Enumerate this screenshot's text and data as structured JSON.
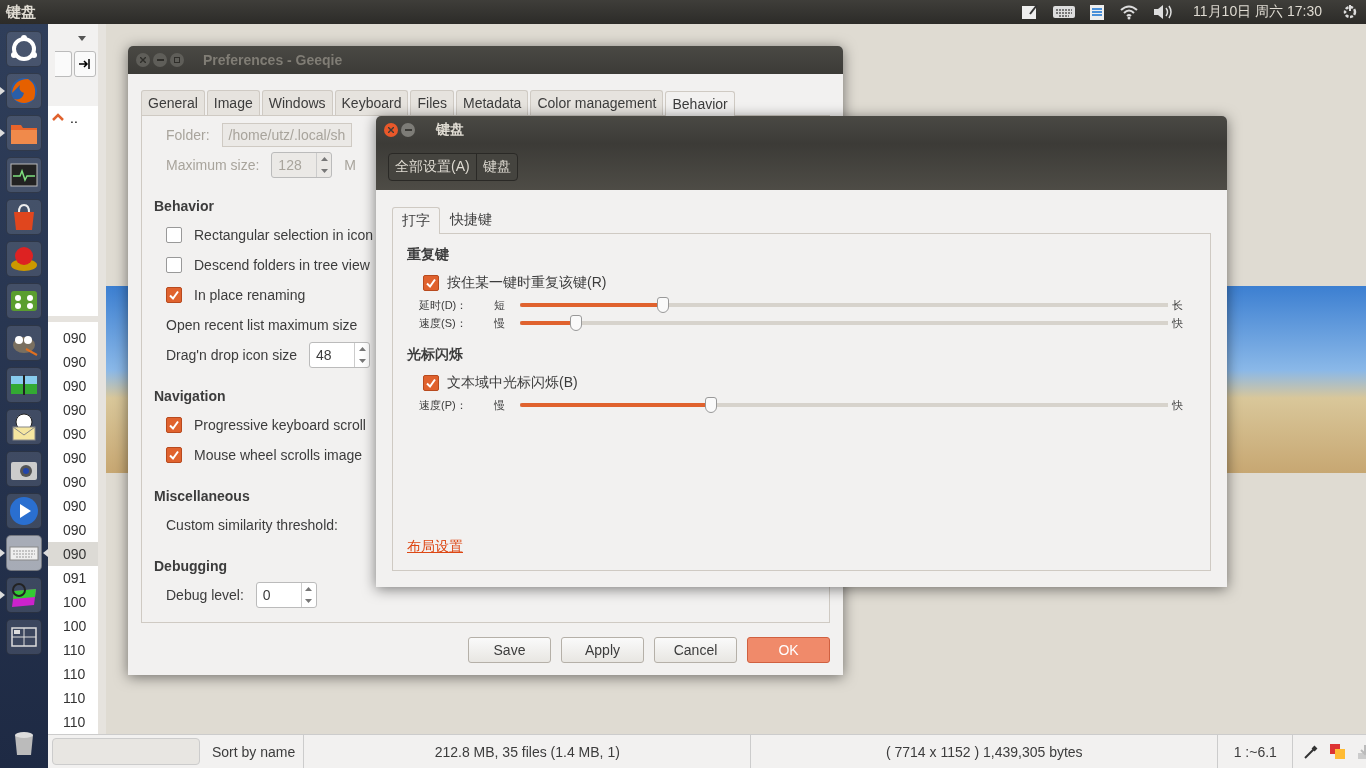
{
  "top_panel": {
    "app_title": "键盘",
    "clock": "11月10日 周六 17:30",
    "indicators": [
      {
        "kind": "pen"
      },
      {
        "kind": "keyboard"
      },
      {
        "kind": "notepad"
      },
      {
        "kind": "wifi"
      },
      {
        "kind": "volume"
      }
    ]
  },
  "launcher": [
    {
      "kind": "ubuntu",
      "running": false,
      "selected": false
    },
    {
      "kind": "firefox",
      "running": true,
      "selected": false
    },
    {
      "kind": "files",
      "running": true,
      "selected": false
    },
    {
      "kind": "monitor",
      "running": false,
      "selected": false
    },
    {
      "kind": "store",
      "running": false,
      "selected": false
    },
    {
      "kind": "disc",
      "running": false,
      "selected": false
    },
    {
      "kind": "dots",
      "running": false,
      "selected": false
    },
    {
      "kind": "gimp",
      "running": false,
      "selected": false
    },
    {
      "kind": "viewer",
      "running": false,
      "selected": false
    },
    {
      "kind": "mail",
      "running": false,
      "selected": false
    },
    {
      "kind": "camera",
      "running": false,
      "selected": false
    },
    {
      "kind": "player",
      "running": false,
      "selected": false
    },
    {
      "kind": "keyboard",
      "running": true,
      "selected": true
    },
    {
      "kind": "color",
      "running": true,
      "selected": false
    },
    {
      "kind": "workspaces",
      "running": false,
      "selected": false
    }
  ],
  "browser": {
    "parent_entry": "..",
    "files": [
      {
        "text": "090",
        "selected": false
      },
      {
        "text": "090",
        "selected": false
      },
      {
        "text": "090",
        "selected": false
      },
      {
        "text": "090",
        "selected": false
      },
      {
        "text": "090",
        "selected": false
      },
      {
        "text": "090",
        "selected": false
      },
      {
        "text": "090",
        "selected": false
      },
      {
        "text": "090",
        "selected": false
      },
      {
        "text": "090",
        "selected": false
      },
      {
        "text": "090",
        "selected": true
      },
      {
        "text": "091",
        "selected": false
      },
      {
        "text": "100",
        "selected": false
      },
      {
        "text": "100",
        "selected": false
      },
      {
        "text": "110",
        "selected": false
      },
      {
        "text": "110",
        "selected": false
      },
      {
        "text": "110",
        "selected": false
      },
      {
        "text": "110",
        "selected": false
      }
    ]
  },
  "status_bar": {
    "sort": "Sort by name",
    "files": "212.8 MB, 35 files (1.4 MB, 1)",
    "image": "( 7714 x 1152 ) 1,439,305 bytes",
    "zoom": "1 :~6.1"
  },
  "preferences": {
    "title": "Preferences - Geeqie",
    "tabs": [
      {
        "label": "General",
        "selected": false
      },
      {
        "label": "Image",
        "selected": false
      },
      {
        "label": "Windows",
        "selected": false
      },
      {
        "label": "Keyboard",
        "selected": false
      },
      {
        "label": "Files",
        "selected": false
      },
      {
        "label": "Metadata",
        "selected": false
      },
      {
        "label": "Color management",
        "selected": false
      },
      {
        "label": "Behavior",
        "selected": true
      }
    ],
    "rows": [
      {
        "kind": "field",
        "label": "Folder:",
        "value": "/home/utz/.local/sh",
        "disabled": true
      },
      {
        "kind": "spin",
        "label": "Maximum size:",
        "value": "128",
        "disabled": true,
        "after": "M"
      },
      {
        "kind": "heading",
        "text": "Behavior"
      },
      {
        "kind": "check",
        "label": "Rectangular selection in icon",
        "checked": false
      },
      {
        "kind": "check",
        "label": "Descend folders in tree view",
        "checked": false
      },
      {
        "kind": "check",
        "label": "In place renaming",
        "checked": true
      },
      {
        "kind": "label",
        "label": "Open recent list maximum size"
      },
      {
        "kind": "spin",
        "label": "Drag'n drop icon size",
        "value": "48",
        "disabled": false
      },
      {
        "kind": "heading",
        "text": "Navigation"
      },
      {
        "kind": "check",
        "label": "Progressive keyboard scroll",
        "checked": true
      },
      {
        "kind": "check",
        "label": "Mouse wheel scrolls image",
        "checked": true
      },
      {
        "kind": "heading",
        "text": "Miscellaneous"
      },
      {
        "kind": "label",
        "label": "Custom similarity threshold:"
      },
      {
        "kind": "heading",
        "text": "Debugging"
      },
      {
        "kind": "spin",
        "label": "Debug level:",
        "value": "0",
        "disabled": false
      }
    ],
    "buttons": [
      {
        "label": "Save",
        "default": false
      },
      {
        "label": "Apply",
        "default": false
      },
      {
        "label": "Cancel",
        "default": false
      },
      {
        "label": "OK",
        "default": true
      }
    ]
  },
  "keyboard_window": {
    "title": "键盘",
    "breadcrumbs": [
      "全部设置(A)",
      "键盘"
    ],
    "tabs": [
      {
        "label": "打字",
        "selected": true
      },
      {
        "label": "快捷键",
        "selected": false
      }
    ],
    "sections": [
      {
        "heading": "重复键",
        "checkbox": {
          "label": "按住某一键时重复该键(R)",
          "checked": true
        },
        "sliders": [
          {
            "label": "延时(D)：",
            "min_label": "短",
            "max_label": "长",
            "level": 0.22
          },
          {
            "label": "速度(S)：",
            "min_label": "慢",
            "max_label": "快",
            "level": 0.086
          }
        ]
      },
      {
        "heading": "光标闪烁",
        "checkbox": {
          "label": "文本域中光标闪烁(B)",
          "checked": true
        },
        "sliders": [
          {
            "label": "速度(P)：",
            "min_label": "慢",
            "max_label": "快",
            "level": 0.295
          }
        ]
      }
    ],
    "link": "布局设置"
  }
}
